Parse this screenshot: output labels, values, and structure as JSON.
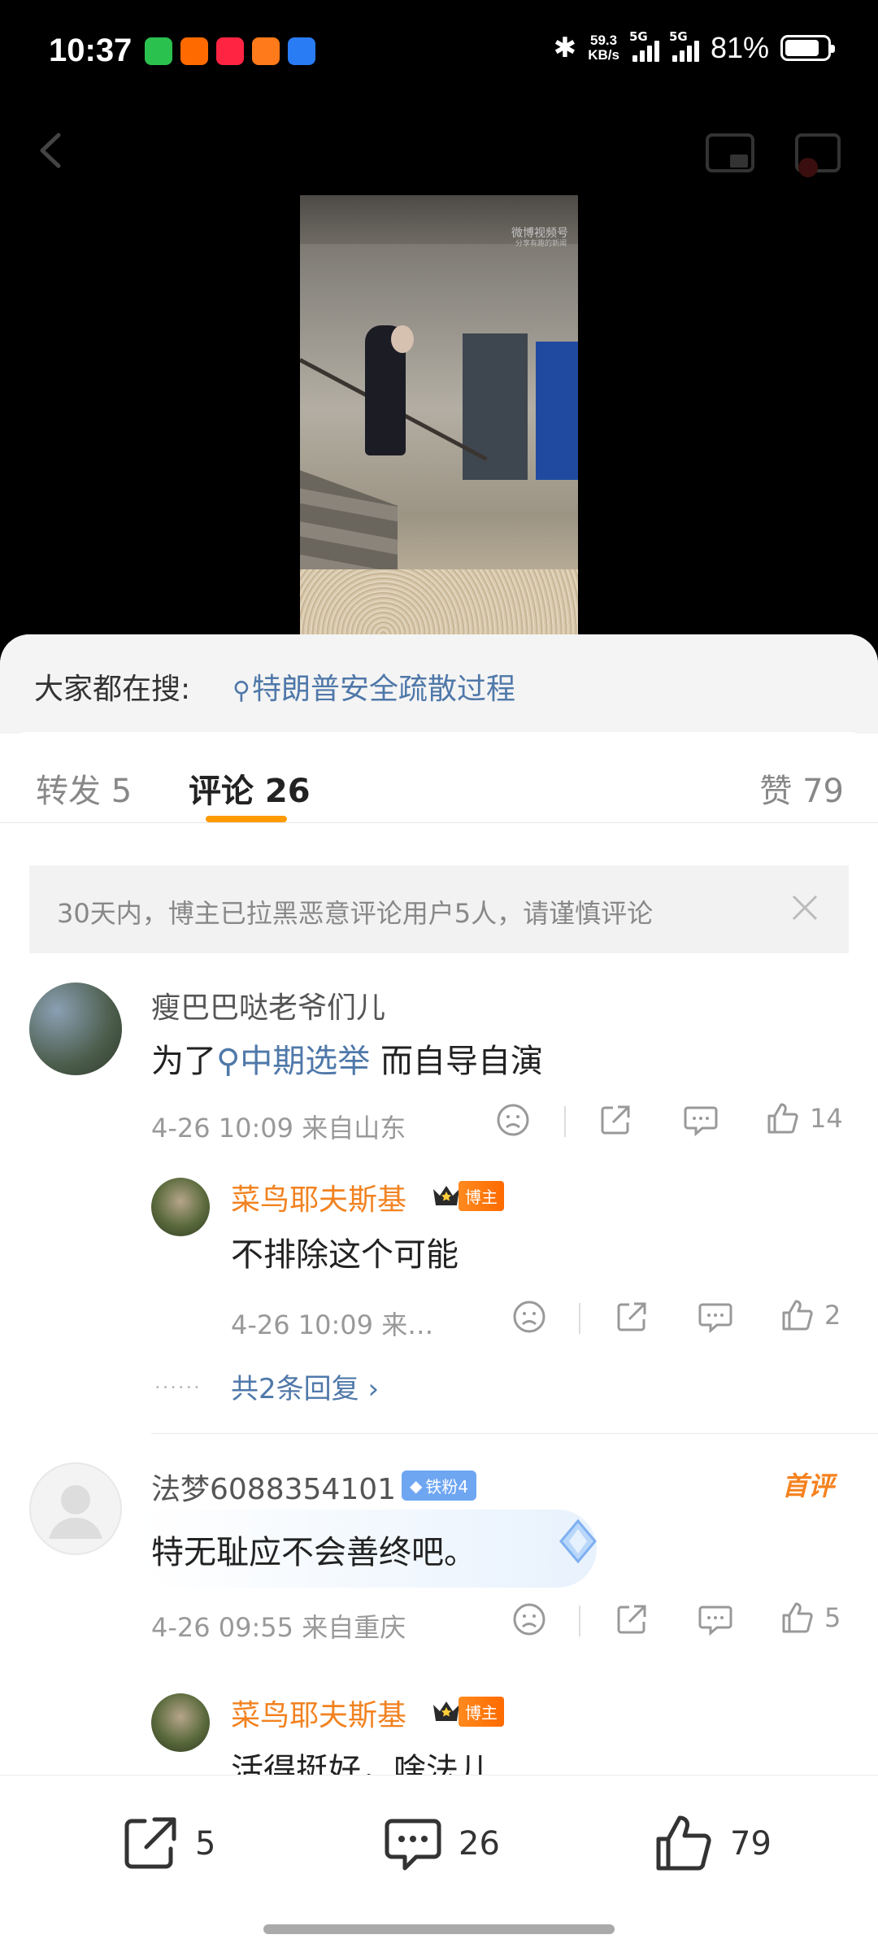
{
  "status_bar": {
    "time": "10:37",
    "net_speed": "59.3",
    "net_unit": "KB/s",
    "sig1": "5G",
    "sig2": "5G",
    "battery": "81%"
  },
  "video": {
    "watermark": "微博视频号",
    "watermark_sub": "分享有趣的新闻"
  },
  "search_hint": {
    "label": "大家都在搜:",
    "query": "特朗普安全疏散过程"
  },
  "tabs": {
    "repost": "转发 5",
    "comment": "评论 26",
    "like": "赞 79"
  },
  "notice": {
    "text": "30天内，博主已拉黑恶意评论用户5人，请谨慎评论"
  },
  "comments": [
    {
      "user": "瘦巴巴哒老爷们儿",
      "text_prefix": "为了",
      "topic": "中期选举",
      "text_suffix": " 而自导自演",
      "meta": "4-26 10:09  来自山东",
      "likes": "14",
      "reply": {
        "user": "菜鸟耶夫斯基",
        "badge": "博主",
        "text": "不排除这个可能",
        "meta": "4-26 10:09  来…",
        "likes": "2"
      },
      "more_replies": "共2条回复 ›"
    },
    {
      "user": "法梦6088354101",
      "fan_badge": "铁粉4",
      "first_tag": "首评",
      "text": "特无耻应不会善终吧。",
      "meta": "4-26 09:55  来自重庆",
      "likes": "5",
      "reply": {
        "user": "菜鸟耶夫斯基",
        "badge": "博主",
        "text": "活得挺好，啥法儿"
      }
    }
  ],
  "bottom_bar": {
    "repost": "5",
    "comment": "26",
    "like": "79"
  },
  "icons": {
    "back": "back-arrow-icon",
    "pip": "pip-icon",
    "screen": "screen-cast-icon",
    "close": "close-icon",
    "dislike": "dislike-face-icon",
    "share": "share-icon",
    "reply": "comment-bubble-icon",
    "like": "thumb-up-icon"
  },
  "colors": {
    "accent": "#ff9a00",
    "link": "#4f78a9",
    "orange_name": "#f28220"
  }
}
